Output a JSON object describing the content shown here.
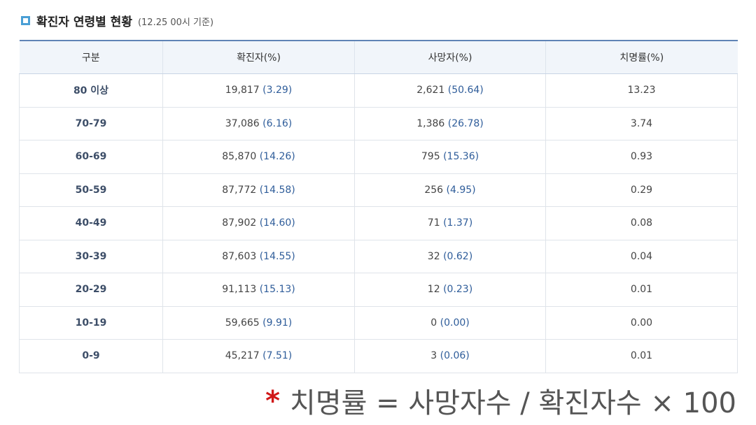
{
  "header": {
    "title": "확진자 연령별 현황",
    "note": "(12.25 00시 기준)"
  },
  "table": {
    "columns": [
      "구분",
      "확진자(%)",
      "사망자(%)",
      "치명률(%)"
    ],
    "rows": [
      {
        "age": "80 이상",
        "cases": "19,817",
        "cases_pct": "(3.29)",
        "deaths": "2,621",
        "deaths_pct": "(50.64)",
        "fatality": "13.23"
      },
      {
        "age": "70-79",
        "cases": "37,086",
        "cases_pct": "(6.16)",
        "deaths": "1,386",
        "deaths_pct": "(26.78)",
        "fatality": "3.74"
      },
      {
        "age": "60-69",
        "cases": "85,870",
        "cases_pct": "(14.26)",
        "deaths": "795",
        "deaths_pct": "(15.36)",
        "fatality": "0.93"
      },
      {
        "age": "50-59",
        "cases": "87,772",
        "cases_pct": "(14.58)",
        "deaths": "256",
        "deaths_pct": "(4.95)",
        "fatality": "0.29"
      },
      {
        "age": "40-49",
        "cases": "87,902",
        "cases_pct": "(14.60)",
        "deaths": "71",
        "deaths_pct": "(1.37)",
        "fatality": "0.08"
      },
      {
        "age": "30-39",
        "cases": "87,603",
        "cases_pct": "(14.55)",
        "deaths": "32",
        "deaths_pct": "(0.62)",
        "fatality": "0.04"
      },
      {
        "age": "20-29",
        "cases": "91,113",
        "cases_pct": "(15.13)",
        "deaths": "12",
        "deaths_pct": "(0.23)",
        "fatality": "0.01"
      },
      {
        "age": "10-19",
        "cases": "59,665",
        "cases_pct": "(9.91)",
        "deaths": "0",
        "deaths_pct": "(0.00)",
        "fatality": "0.00"
      },
      {
        "age": "0-9",
        "cases": "45,217",
        "cases_pct": "(7.51)",
        "deaths": "3",
        "deaths_pct": "(0.06)",
        "fatality": "0.01"
      }
    ]
  },
  "footnote": {
    "marker": "*",
    "text": "치명률 = 사망자수 / 확진자수 × 100"
  },
  "colors": {
    "accent": "#4a9fd5",
    "header_border": "#5f83b5",
    "header_bg": "#f1f5fa",
    "value_blue": "#2f5d9a",
    "marker_red": "#d01818"
  }
}
